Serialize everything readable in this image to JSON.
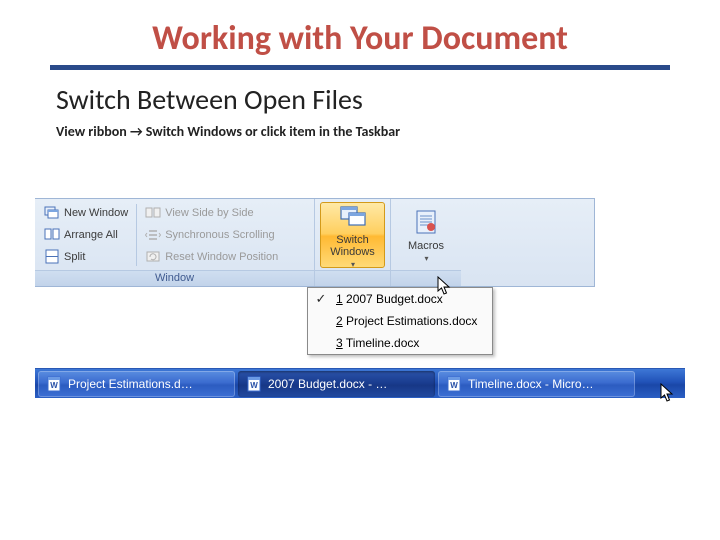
{
  "title": "Working with Your Document",
  "subtitle": "Switch Between Open Files",
  "instruction": "View ribbon → Switch Windows or click item in the Taskbar",
  "ribbon": {
    "group_window": {
      "new_window": "New Window",
      "arrange_all": "Arrange All",
      "split": "Split",
      "side_by_side": "View Side by Side",
      "sync_scroll": "Synchronous Scrolling",
      "reset_pos": "Reset Window Position",
      "switch_windows_line1": "Switch",
      "switch_windows_line2": "Windows",
      "group_label": "Window"
    },
    "group_macros": {
      "macros": "Macros"
    }
  },
  "dropdown": {
    "items": [
      {
        "accel": "1",
        "label": "2007 Budget.docx",
        "checked": true
      },
      {
        "accel": "2",
        "label": "Project Estimations.docx",
        "checked": false
      },
      {
        "accel": "3",
        "label": "Timeline.docx",
        "checked": false
      }
    ]
  },
  "taskbar": {
    "items": [
      {
        "label": "Project Estimations.d…",
        "active": false
      },
      {
        "label": "2007 Budget.docx - …",
        "active": true
      },
      {
        "label": "Timeline.docx - Micro…",
        "active": false
      }
    ]
  }
}
